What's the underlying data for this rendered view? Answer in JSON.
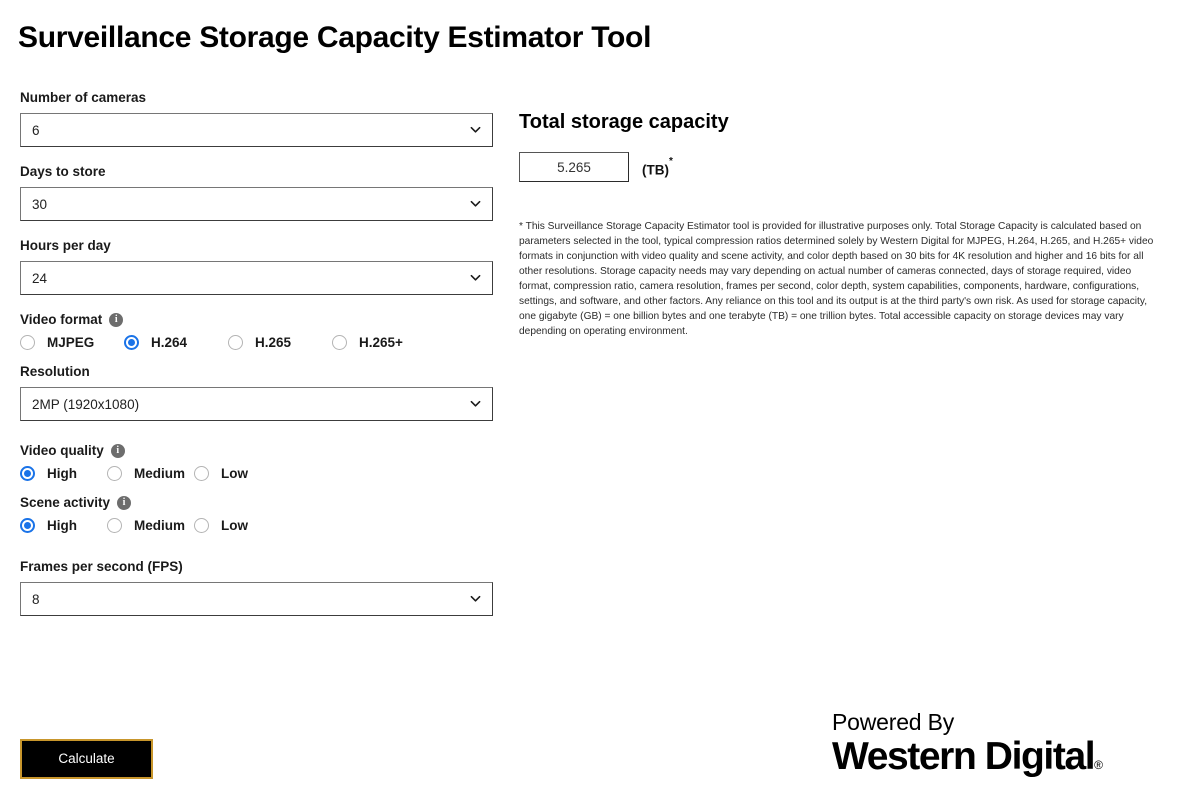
{
  "page": {
    "title": "Surveillance Storage Capacity Estimator Tool"
  },
  "form": {
    "cameras": {
      "label": "Number of cameras",
      "value": "6"
    },
    "days": {
      "label": "Days to store",
      "value": "30"
    },
    "hours": {
      "label": "Hours per day",
      "value": "24"
    },
    "video_format": {
      "label": "Video format",
      "info_icon": "info-icon",
      "options": [
        {
          "label": "MJPEG",
          "selected": false
        },
        {
          "label": "H.264",
          "selected": true
        },
        {
          "label": "H.265",
          "selected": false
        },
        {
          "label": "H.265+",
          "selected": false
        }
      ]
    },
    "resolution": {
      "label": "Resolution",
      "value": "2MP (1920x1080)"
    },
    "video_quality": {
      "label": "Video quality",
      "info_icon": "info-icon",
      "options": [
        {
          "label": "High",
          "selected": true
        },
        {
          "label": "Medium",
          "selected": false
        },
        {
          "label": "Low",
          "selected": false
        }
      ]
    },
    "scene_activity": {
      "label": "Scene activity",
      "info_icon": "info-icon",
      "options": [
        {
          "label": "High",
          "selected": true
        },
        {
          "label": "Medium",
          "selected": false
        },
        {
          "label": "Low",
          "selected": false
        }
      ]
    },
    "fps": {
      "label": "Frames per second (FPS)",
      "value": "8"
    },
    "calculate_label": "Calculate"
  },
  "result": {
    "title": "Total storage capacity",
    "value": "5.265",
    "unit": "(TB)",
    "unit_superscript": "*",
    "disclaimer": "* This Surveillance Storage Capacity Estimator tool is provided for illustrative purposes only. Total Storage Capacity is calculated based on parameters selected in the tool, typical compression ratios determined solely by Western Digital for MJPEG, H.264, H.265, and H.265+ video formats in conjunction with video quality and scene activity, and color depth based on 30 bits for 4K resolution and higher and 16 bits for all other resolutions. Storage capacity needs may vary depending on actual number of cameras connected, days of storage required, video format, compression ratio, camera resolution, frames per second, color depth, system capabilities, components, hardware, configurations, settings, and software, and other factors. Any reliance on this tool and its output is at the third party's own risk. As used for storage capacity, one gigabyte (GB) = one billion bytes and one terabyte (TB) = one trillion bytes. Total accessible capacity on storage devices may vary depending on operating environment."
  },
  "logo": {
    "powered_by": "Powered By",
    "brand": "Western Digital",
    "registered": "®"
  },
  "colors": {
    "accent_blue": "#1a73e8",
    "button_border_gold": "#c8962c",
    "button_bg": "#000000",
    "info_icon_gray": "#6d6d6d"
  }
}
